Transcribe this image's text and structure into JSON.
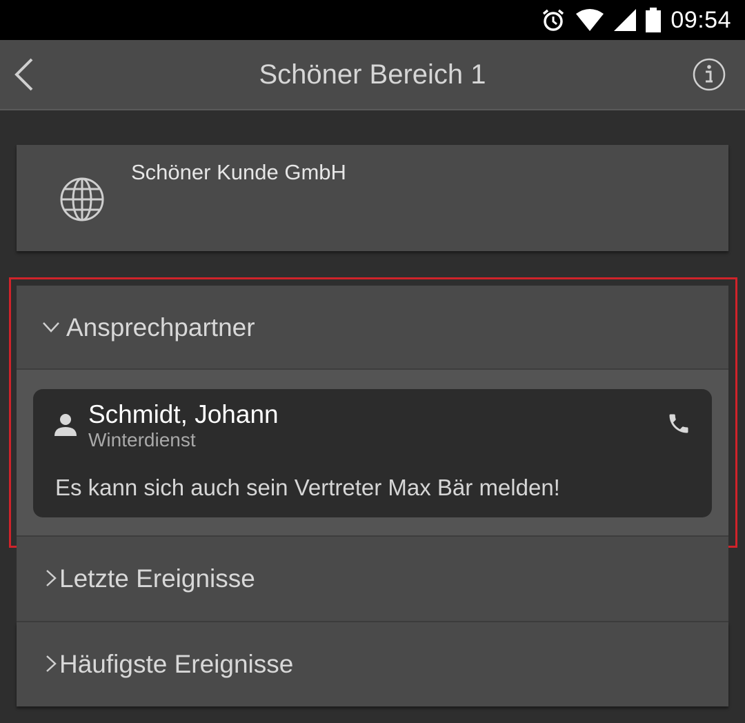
{
  "status_bar": {
    "time": "09:54",
    "icons": [
      "alarm-icon",
      "wifi-icon",
      "cell-signal-icon",
      "battery-icon"
    ]
  },
  "app_bar": {
    "title": "Schöner Bereich 1",
    "back_icon": "chevron-left-icon",
    "info_icon": "info-icon"
  },
  "customer": {
    "icon": "globe-icon",
    "name": "Schöner Kunde GmbH"
  },
  "sections": {
    "contacts": {
      "label": "Ansprechpartner",
      "expanded": true,
      "contact": {
        "name": "Schmidt, Johann",
        "role": "Winterdienst",
        "note": "Es kann sich auch sein Vertreter Max Bär melden!",
        "icon": "person-icon",
        "action_icon": "phone-icon"
      }
    },
    "recent_events": {
      "label": "Letzte Ereignisse",
      "expanded": false
    },
    "frequent_events": {
      "label": "Häufigste Ereignisse",
      "expanded": false
    }
  },
  "colors": {
    "highlight": "#d0232a",
    "card_bg": "#4a4a4a",
    "page_bg": "#2e2e2e",
    "contact_card_bg": "#2c2c2c"
  }
}
